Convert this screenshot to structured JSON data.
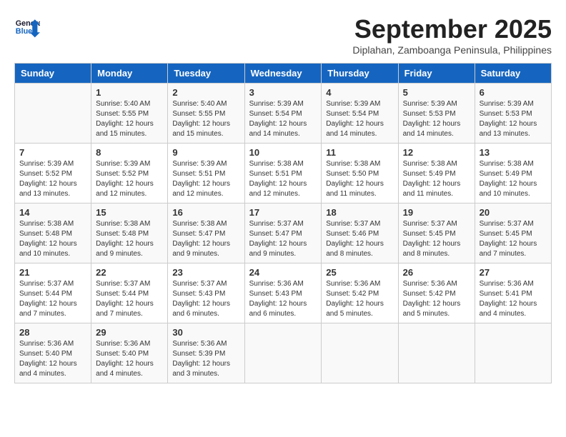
{
  "header": {
    "logo_line1": "General",
    "logo_line2": "Blue",
    "month": "September 2025",
    "location": "Diplahan, Zamboanga Peninsula, Philippines"
  },
  "days_of_week": [
    "Sunday",
    "Monday",
    "Tuesday",
    "Wednesday",
    "Thursday",
    "Friday",
    "Saturday"
  ],
  "weeks": [
    [
      {
        "day": "",
        "info": ""
      },
      {
        "day": "1",
        "info": "Sunrise: 5:40 AM\nSunset: 5:55 PM\nDaylight: 12 hours\nand 15 minutes."
      },
      {
        "day": "2",
        "info": "Sunrise: 5:40 AM\nSunset: 5:55 PM\nDaylight: 12 hours\nand 15 minutes."
      },
      {
        "day": "3",
        "info": "Sunrise: 5:39 AM\nSunset: 5:54 PM\nDaylight: 12 hours\nand 14 minutes."
      },
      {
        "day": "4",
        "info": "Sunrise: 5:39 AM\nSunset: 5:54 PM\nDaylight: 12 hours\nand 14 minutes."
      },
      {
        "day": "5",
        "info": "Sunrise: 5:39 AM\nSunset: 5:53 PM\nDaylight: 12 hours\nand 14 minutes."
      },
      {
        "day": "6",
        "info": "Sunrise: 5:39 AM\nSunset: 5:53 PM\nDaylight: 12 hours\nand 13 minutes."
      }
    ],
    [
      {
        "day": "7",
        "info": "Sunrise: 5:39 AM\nSunset: 5:52 PM\nDaylight: 12 hours\nand 13 minutes."
      },
      {
        "day": "8",
        "info": "Sunrise: 5:39 AM\nSunset: 5:52 PM\nDaylight: 12 hours\nand 12 minutes."
      },
      {
        "day": "9",
        "info": "Sunrise: 5:39 AM\nSunset: 5:51 PM\nDaylight: 12 hours\nand 12 minutes."
      },
      {
        "day": "10",
        "info": "Sunrise: 5:38 AM\nSunset: 5:51 PM\nDaylight: 12 hours\nand 12 minutes."
      },
      {
        "day": "11",
        "info": "Sunrise: 5:38 AM\nSunset: 5:50 PM\nDaylight: 12 hours\nand 11 minutes."
      },
      {
        "day": "12",
        "info": "Sunrise: 5:38 AM\nSunset: 5:49 PM\nDaylight: 12 hours\nand 11 minutes."
      },
      {
        "day": "13",
        "info": "Sunrise: 5:38 AM\nSunset: 5:49 PM\nDaylight: 12 hours\nand 10 minutes."
      }
    ],
    [
      {
        "day": "14",
        "info": "Sunrise: 5:38 AM\nSunset: 5:48 PM\nDaylight: 12 hours\nand 10 minutes."
      },
      {
        "day": "15",
        "info": "Sunrise: 5:38 AM\nSunset: 5:48 PM\nDaylight: 12 hours\nand 9 minutes."
      },
      {
        "day": "16",
        "info": "Sunrise: 5:38 AM\nSunset: 5:47 PM\nDaylight: 12 hours\nand 9 minutes."
      },
      {
        "day": "17",
        "info": "Sunrise: 5:37 AM\nSunset: 5:47 PM\nDaylight: 12 hours\nand 9 minutes."
      },
      {
        "day": "18",
        "info": "Sunrise: 5:37 AM\nSunset: 5:46 PM\nDaylight: 12 hours\nand 8 minutes."
      },
      {
        "day": "19",
        "info": "Sunrise: 5:37 AM\nSunset: 5:45 PM\nDaylight: 12 hours\nand 8 minutes."
      },
      {
        "day": "20",
        "info": "Sunrise: 5:37 AM\nSunset: 5:45 PM\nDaylight: 12 hours\nand 7 minutes."
      }
    ],
    [
      {
        "day": "21",
        "info": "Sunrise: 5:37 AM\nSunset: 5:44 PM\nDaylight: 12 hours\nand 7 minutes."
      },
      {
        "day": "22",
        "info": "Sunrise: 5:37 AM\nSunset: 5:44 PM\nDaylight: 12 hours\nand 7 minutes."
      },
      {
        "day": "23",
        "info": "Sunrise: 5:37 AM\nSunset: 5:43 PM\nDaylight: 12 hours\nand 6 minutes."
      },
      {
        "day": "24",
        "info": "Sunrise: 5:36 AM\nSunset: 5:43 PM\nDaylight: 12 hours\nand 6 minutes."
      },
      {
        "day": "25",
        "info": "Sunrise: 5:36 AM\nSunset: 5:42 PM\nDaylight: 12 hours\nand 5 minutes."
      },
      {
        "day": "26",
        "info": "Sunrise: 5:36 AM\nSunset: 5:42 PM\nDaylight: 12 hours\nand 5 minutes."
      },
      {
        "day": "27",
        "info": "Sunrise: 5:36 AM\nSunset: 5:41 PM\nDaylight: 12 hours\nand 4 minutes."
      }
    ],
    [
      {
        "day": "28",
        "info": "Sunrise: 5:36 AM\nSunset: 5:40 PM\nDaylight: 12 hours\nand 4 minutes."
      },
      {
        "day": "29",
        "info": "Sunrise: 5:36 AM\nSunset: 5:40 PM\nDaylight: 12 hours\nand 4 minutes."
      },
      {
        "day": "30",
        "info": "Sunrise: 5:36 AM\nSunset: 5:39 PM\nDaylight: 12 hours\nand 3 minutes."
      },
      {
        "day": "",
        "info": ""
      },
      {
        "day": "",
        "info": ""
      },
      {
        "day": "",
        "info": ""
      },
      {
        "day": "",
        "info": ""
      }
    ]
  ]
}
